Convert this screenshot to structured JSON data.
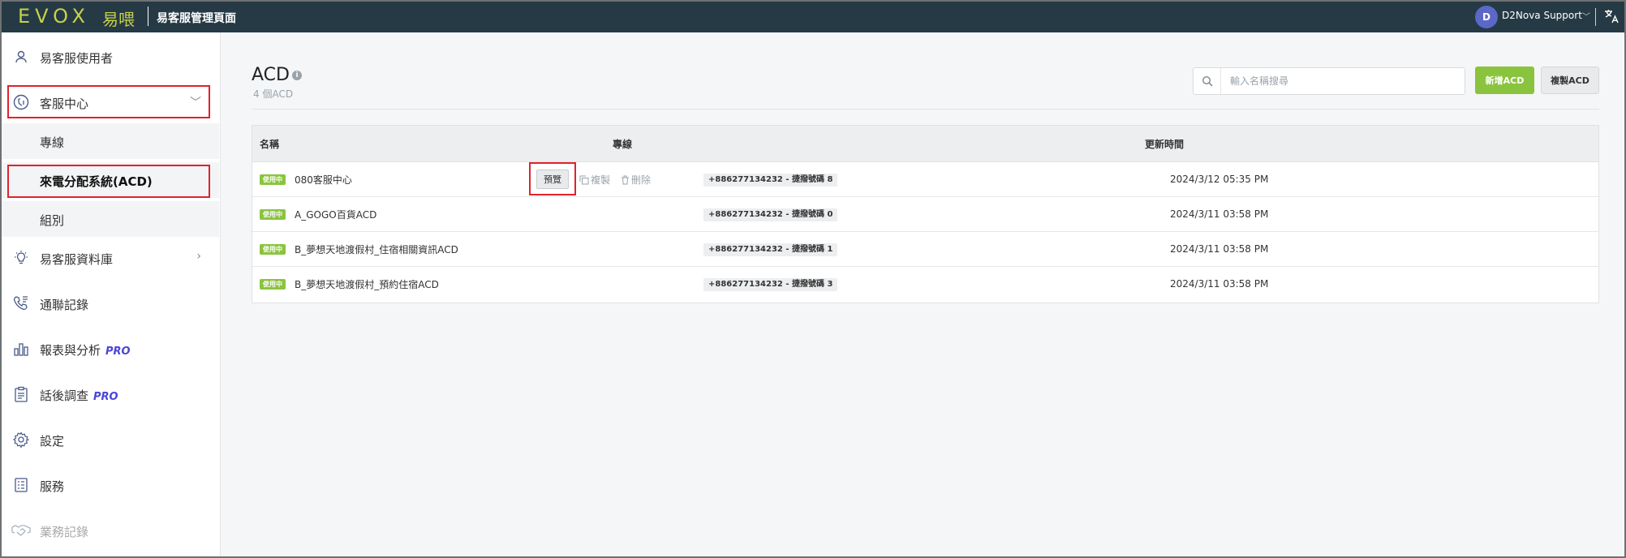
{
  "header": {
    "logo_text": "EVOX",
    "logo_cn": "易喂",
    "app_title": "易客服管理頁面",
    "user_initial": "D",
    "user_name": "D2Nova Support",
    "user_chevron": "﹀",
    "lang_icon": "translate-icon"
  },
  "sidebar": {
    "items": [
      {
        "label": "易客服使用者",
        "icon": "user-icon"
      },
      {
        "label": "客服中心",
        "icon": "call-center-icon",
        "chevron": "﹀"
      },
      {
        "label": "專線"
      },
      {
        "label": "來電分配系統(ACD)"
      },
      {
        "label": "組別"
      },
      {
        "label": "易客服資料庫",
        "icon": "lightbulb-icon",
        "chevron": "›"
      },
      {
        "label": "通聯記錄",
        "icon": "phone-log-icon"
      },
      {
        "label": "報表與分析",
        "icon": "bar-chart-icon",
        "pro": "PRO"
      },
      {
        "label": "話後調查",
        "icon": "survey-icon",
        "pro": "PRO"
      },
      {
        "label": "設定",
        "icon": "gear-icon"
      },
      {
        "label": "服務",
        "icon": "service-list-icon"
      },
      {
        "label": "業務記錄",
        "icon": "handshake-icon"
      }
    ]
  },
  "main": {
    "title": "ACD",
    "info": "i",
    "subtitle": "4 個ACD",
    "search_placeholder": "輸入名稱搜尋",
    "new_button": "新增ACD",
    "copy_button": "複製ACD",
    "columns": [
      "名稱",
      "專線",
      "更新時間"
    ],
    "row_actions": {
      "preview": "預覽",
      "copy": "複製",
      "delete": "刪除"
    },
    "rows": [
      {
        "status": "使用中",
        "name": "080客服中心",
        "line": "+886277134232 - 捷撥號碼 8",
        "updated": "2024/3/12 05:35 PM"
      },
      {
        "status": "使用中",
        "name": "A_GOGO百貨ACD",
        "line": "+886277134232 - 捷撥號碼 0",
        "updated": "2024/3/11 03:58 PM"
      },
      {
        "status": "使用中",
        "name": "B_夢想天地渡假村_住宿相關資訊ACD",
        "line": "+886277134232 - 捷撥號碼 1",
        "updated": "2024/3/11 03:58 PM"
      },
      {
        "status": "使用中",
        "name": "B_夢想天地渡假村_預約住宿ACD",
        "line": "+886277134232 - 捷撥號碼 3",
        "updated": "2024/3/11 03:58 PM"
      }
    ]
  },
  "colors": {
    "topbar": "#263a45",
    "brand": "#c6d14a",
    "accent_green": "#8ac43f",
    "highlight_red": "#e2212b",
    "pro_blue": "#4a46d8"
  }
}
